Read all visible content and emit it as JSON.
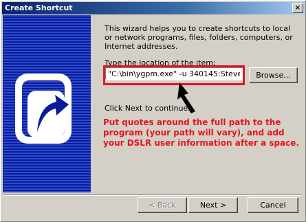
{
  "window": {
    "title": "Create Shortcut",
    "close_glyph": "×"
  },
  "wizard": {
    "intro": "This wizard helps you to create shortcuts to local or network programs, files, folders, computers, or Internet addresses.",
    "location_label": "Type the location of the item:",
    "location_value": "\"C:\\bin\\ygpm.exe\" -u 340145:Steve",
    "browse_label": "Browse...",
    "click_next": "Click Next to continue."
  },
  "annotation": {
    "text": "Put quotes around the full path to the program (your path will vary), and add your DSLR user information after a space.",
    "color": "#e8141e"
  },
  "footer": {
    "back_label": "< Back",
    "next_label": "Next >",
    "cancel_label": "Cancel"
  },
  "icons": {
    "side": "shortcut-arrow-icon",
    "arrow": "pointer-arrow-icon"
  }
}
